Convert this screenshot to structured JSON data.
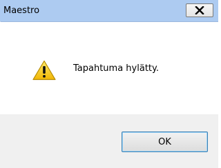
{
  "window": {
    "title": "Maestro"
  },
  "message": {
    "text": "Tapahtuma hylätty.",
    "icon": "warning-icon"
  },
  "buttons": {
    "ok_label": "OK"
  },
  "colors": {
    "titlebar": "#adcbf1",
    "content_bg": "#ffffff",
    "footer_bg": "#f0f0f0",
    "ok_border": "#3c7fb1",
    "warning_yellow": "#f8d21c"
  }
}
